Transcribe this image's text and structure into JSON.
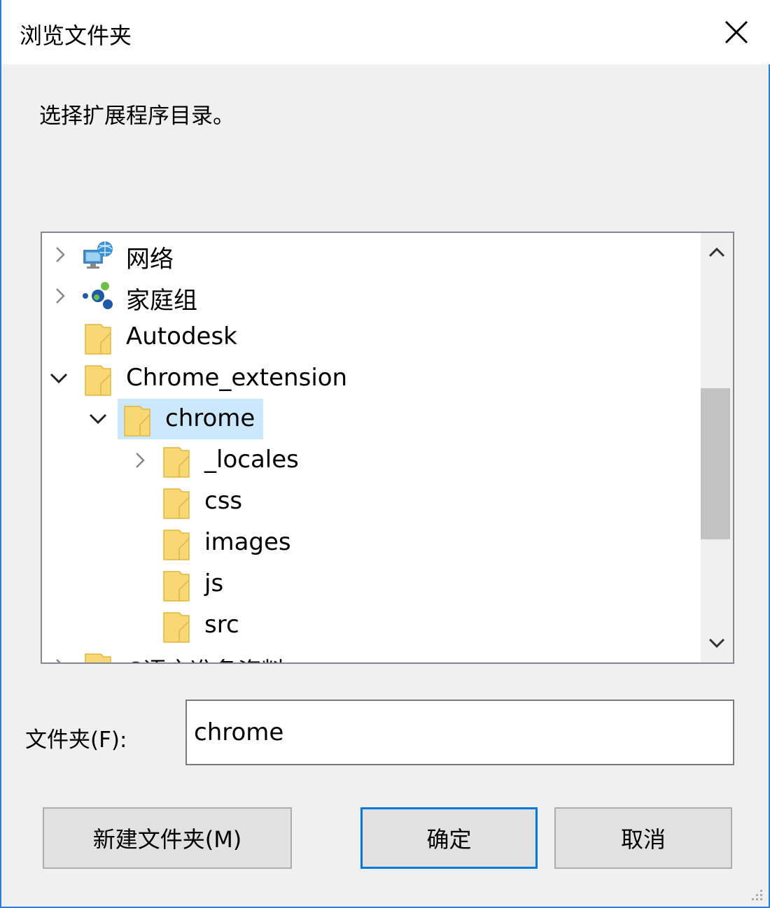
{
  "window": {
    "title": "浏览文件夹"
  },
  "instruction": "选择扩展程序目录。",
  "tree": {
    "items": [
      {
        "label": "网络",
        "icon": "network-icon",
        "expander": "collapsed"
      },
      {
        "label": "家庭组",
        "icon": "homegroup-icon",
        "expander": "collapsed"
      },
      {
        "label": "Autodesk",
        "icon": "folder-icon",
        "expander": "none"
      },
      {
        "label": "Chrome_extension",
        "icon": "folder-icon",
        "expander": "expanded"
      },
      {
        "label": "chrome",
        "icon": "folder-icon",
        "expander": "expanded",
        "selected": true
      },
      {
        "label": "_locales",
        "icon": "folder-icon",
        "expander": "collapsed"
      },
      {
        "label": "css",
        "icon": "folder-icon",
        "expander": "none"
      },
      {
        "label": "images",
        "icon": "folder-icon",
        "expander": "none"
      },
      {
        "label": "js",
        "icon": "folder-icon",
        "expander": "none"
      },
      {
        "label": "src",
        "icon": "folder-icon",
        "expander": "none"
      },
      {
        "label": "C语言准备资料",
        "icon": "folder-icon",
        "expander": "collapsed",
        "partially_visible": true
      }
    ]
  },
  "folder_field": {
    "label": "文件夹(F):",
    "value": "chrome"
  },
  "buttons": {
    "new_folder": "新建文件夹(M)",
    "ok": "确定",
    "cancel": "取消"
  },
  "colors": {
    "selection": "#cce8ff",
    "folder": "#f8d775",
    "accent": "#0078d7"
  }
}
